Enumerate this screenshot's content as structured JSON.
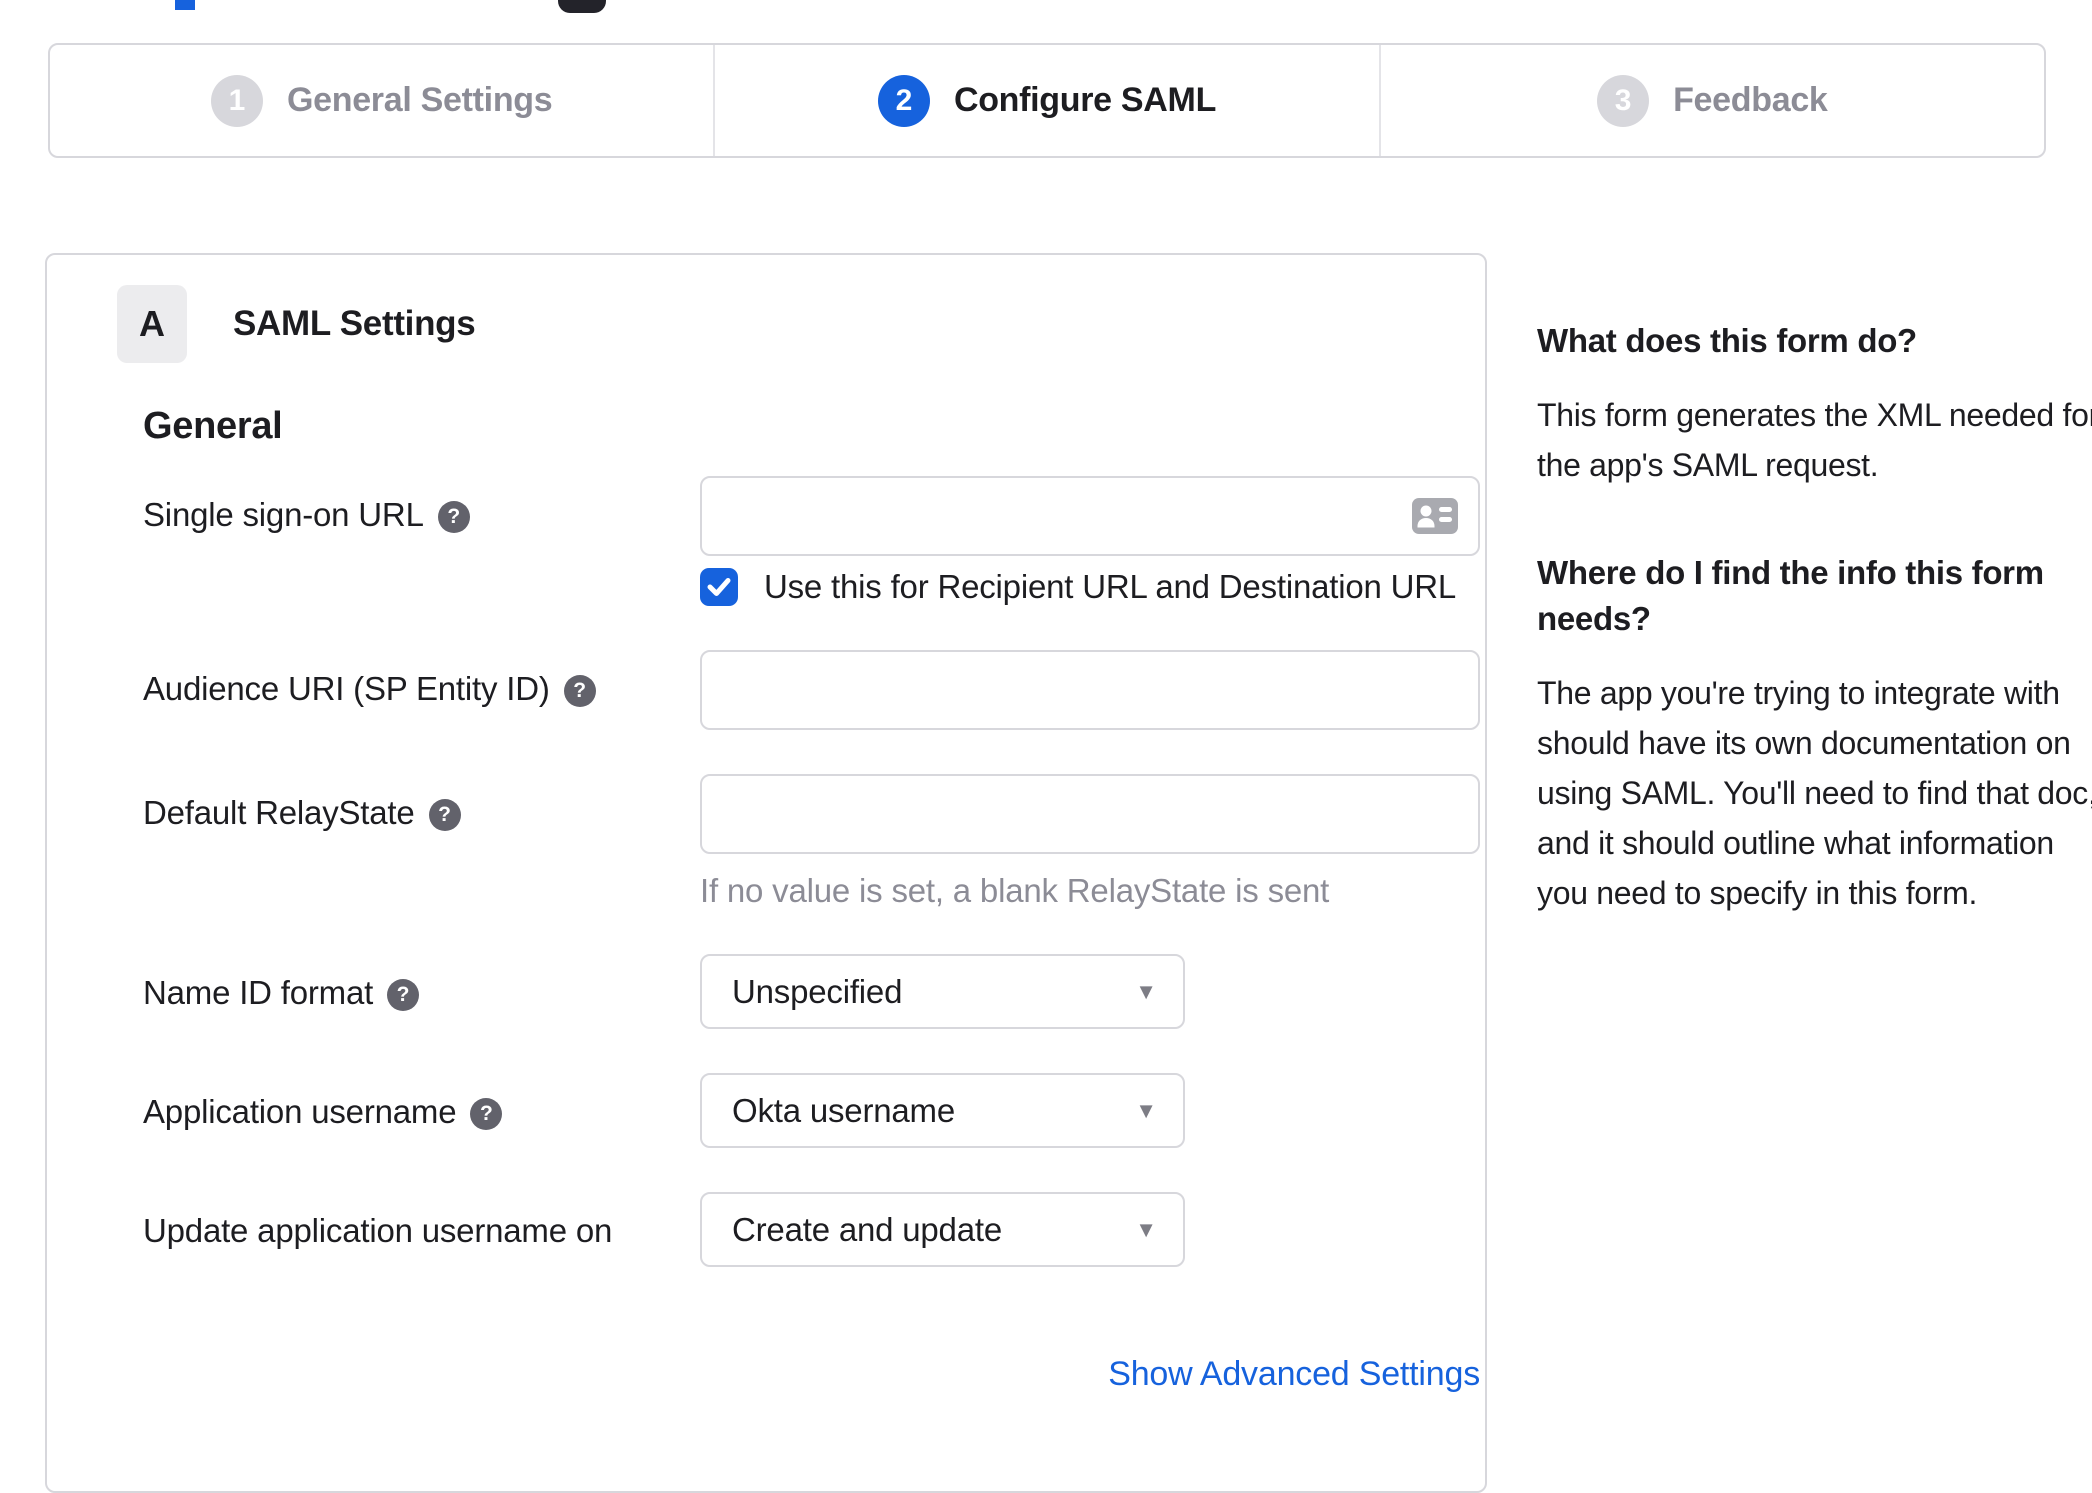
{
  "stepper": {
    "steps": [
      {
        "number": "1",
        "label": "General Settings",
        "state": "inactive"
      },
      {
        "number": "2",
        "label": "Configure SAML",
        "state": "active"
      },
      {
        "number": "3",
        "label": "Feedback",
        "state": "inactive"
      }
    ]
  },
  "panel": {
    "badge": "A",
    "title": "SAML Settings",
    "section": "General",
    "fields": {
      "sso_url": {
        "label": "Single sign-on URL",
        "value": "",
        "checkbox_label": "Use this for Recipient URL and Destination URL",
        "checkbox_checked": true
      },
      "audience_uri": {
        "label": "Audience URI (SP Entity ID)",
        "value": ""
      },
      "relay_state": {
        "label": "Default RelayState",
        "value": "",
        "hint": "If no value is set, a blank RelayState is sent"
      },
      "name_id_format": {
        "label": "Name ID format",
        "value": "Unspecified"
      },
      "app_username": {
        "label": "Application username",
        "value": "Okta username"
      },
      "update_username": {
        "label": "Update application username on",
        "value": "Create and update"
      }
    },
    "advanced_link": "Show Advanced Settings"
  },
  "sidebar": {
    "sections": [
      {
        "heading": "What does this form do?",
        "body": "This form generates the XML needed for the app's SAML request."
      },
      {
        "heading": "Where do I find the info this form needs?",
        "body": "The app you're trying to integrate with should have its own documentation on using SAML. You'll need to find that doc, and it should outline what information you need to specify in this form."
      }
    ]
  },
  "icons": {
    "help_glyph": "?",
    "caret_glyph": "▼"
  },
  "colors": {
    "accent": "#1662dd",
    "text": "#1d1d21",
    "muted": "#8c8c96",
    "border": "#d7d7dc",
    "help_icon_bg": "#62626b"
  }
}
